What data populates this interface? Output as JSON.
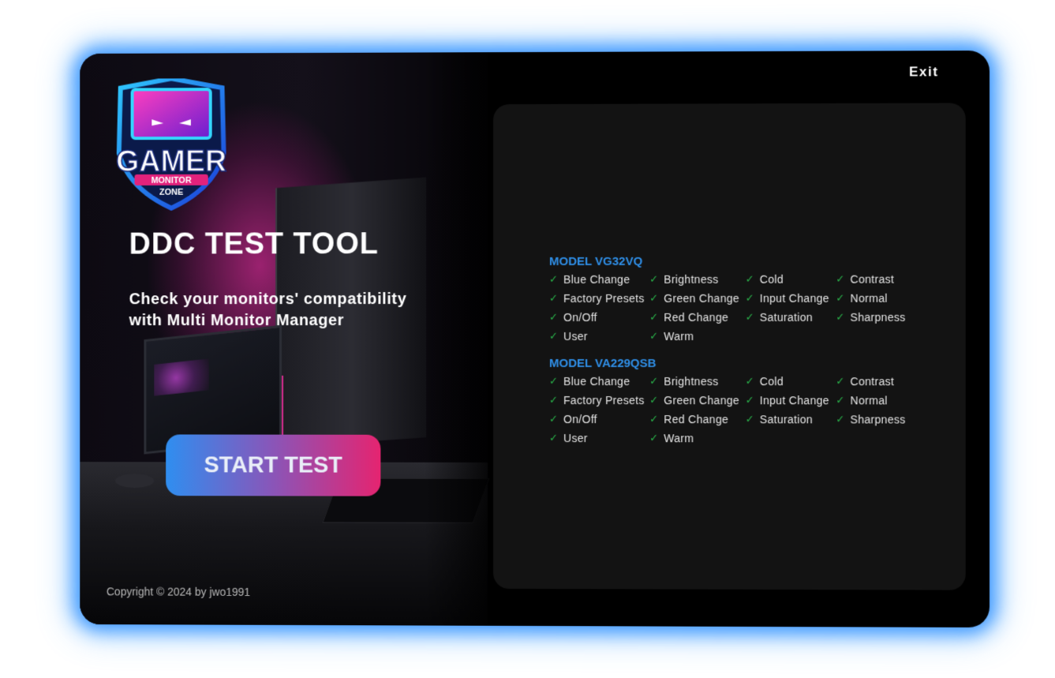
{
  "app": {
    "logo_text": {
      "line1": "GAMER",
      "line2": "MONITOR",
      "line3": "ZONE"
    },
    "title": "DDC TEST TOOL",
    "subtitle_line1": "Check your monitors' compatibility",
    "subtitle_line2": "with Multi Monitor Manager",
    "start_button": "START TEST",
    "copyright": "Copyright © 2024 by jwo1991",
    "exit_label": "Exit"
  },
  "colors": {
    "accent_blue": "#2f8fe8",
    "check_green": "#29b34a",
    "button_gradient_start": "#2f8ef0",
    "button_gradient_end": "#e52470",
    "glow": "#3a8ff5"
  },
  "models": [
    {
      "title": "MODEL VG32VQ",
      "features": [
        "Blue Change",
        "Brightness",
        "Cold",
        "Contrast",
        "Factory Presets",
        "Green Change",
        "Input Change",
        "Normal",
        "On/Off",
        "Red Change",
        "Saturation",
        "Sharpness",
        "User",
        "Warm"
      ]
    },
    {
      "title": "MODEL VA229QSB",
      "features": [
        "Blue Change",
        "Brightness",
        "Cold",
        "Contrast",
        "Factory Presets",
        "Green Change",
        "Input Change",
        "Normal",
        "On/Off",
        "Red Change",
        "Saturation",
        "Sharpness",
        "User",
        "Warm"
      ]
    }
  ],
  "icons": {
    "feature_status": "check-icon"
  }
}
